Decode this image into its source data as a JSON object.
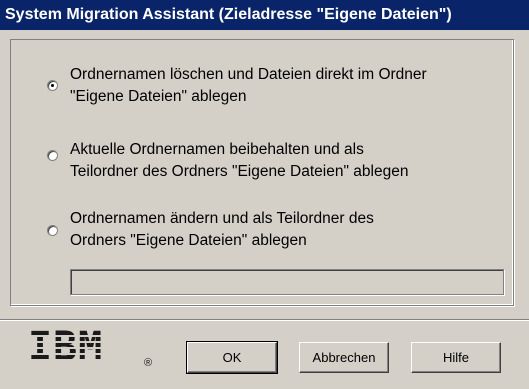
{
  "window": {
    "title": "System Migration Assistant (Zieladresse \"Eigene Dateien\")"
  },
  "options": [
    {
      "line1": "Ordnernamen löschen und Dateien direkt im Ordner",
      "line2": "\"Eigene Dateien\" ablegen",
      "checked": true
    },
    {
      "line1": "Aktuelle Ordnernamen beibehalten und als",
      "line2": "Teilordner des Ordners \"Eigene Dateien\" ablegen",
      "checked": false
    },
    {
      "line1": "Ordnernamen ändern und als Teilordner des",
      "line2": "Ordners \"Eigene Dateien\" ablegen",
      "checked": false
    }
  ],
  "folder_name_input": {
    "value": ""
  },
  "logo": {
    "text": "IBM",
    "registered": "®"
  },
  "buttons": {
    "ok": "OK",
    "cancel": "Abbrechen",
    "help": "Hilfe"
  }
}
